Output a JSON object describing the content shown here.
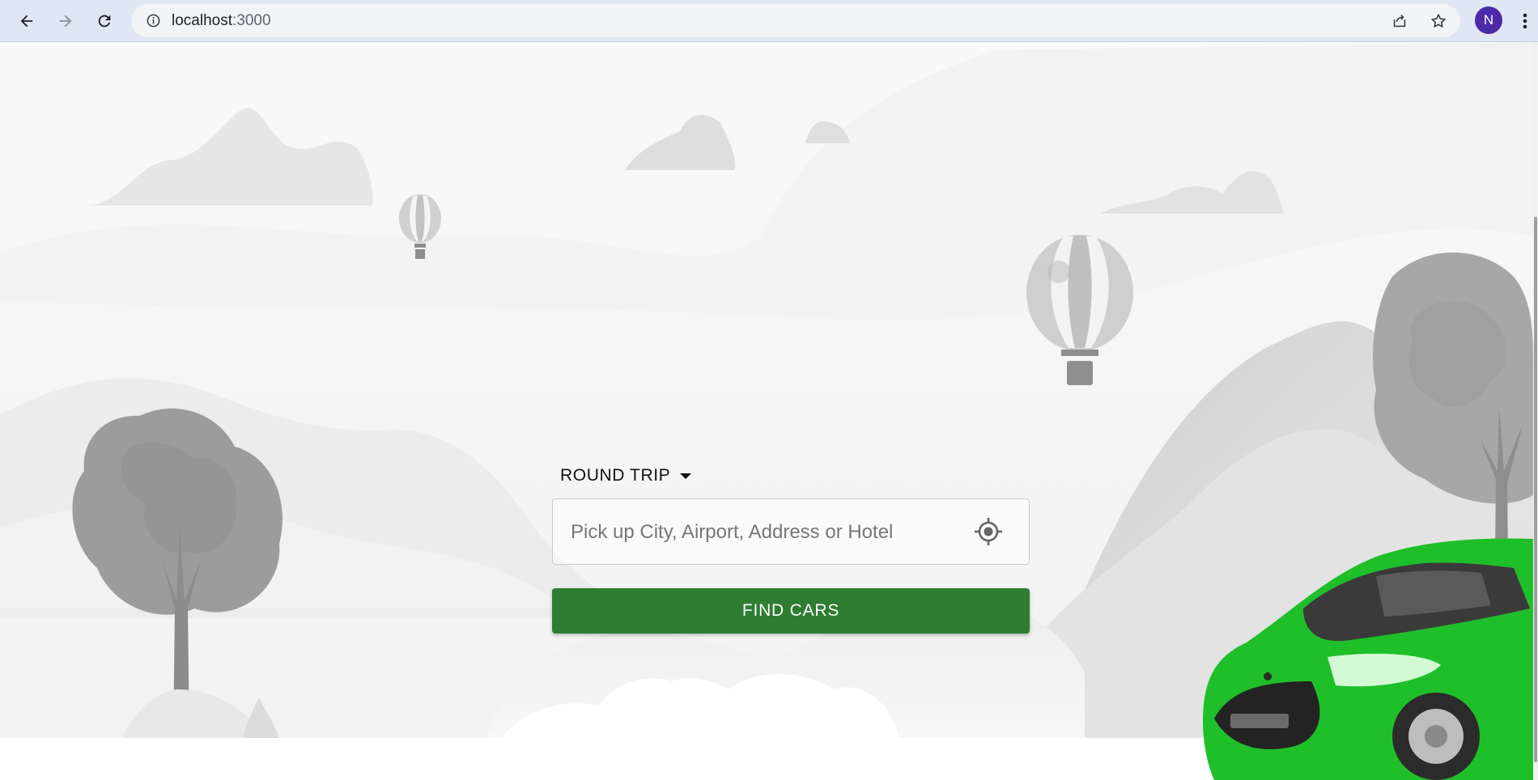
{
  "browser": {
    "url_host": "localhost",
    "url_port": ":3000",
    "profile_initial": "N",
    "icons": [
      "back-arrow-icon",
      "forward-arrow-icon",
      "reload-icon",
      "info-icon",
      "share-icon",
      "star-icon",
      "more-vert-icon"
    ],
    "profile_color": "#4b2aa7"
  },
  "search": {
    "trip_type": "ROUND TRIP",
    "pickup_placeholder": "Pick up City, Airport, Address or Hotel",
    "pickup_value": "",
    "find_button": "FIND CARS"
  },
  "colors": {
    "accent": "#2e7d32",
    "car": "#1fbf2a"
  },
  "scene_elements": [
    "hot-air-balloon",
    "hot-air-balloon",
    "tree",
    "tree",
    "mountains",
    "clouds",
    "green-car"
  ]
}
